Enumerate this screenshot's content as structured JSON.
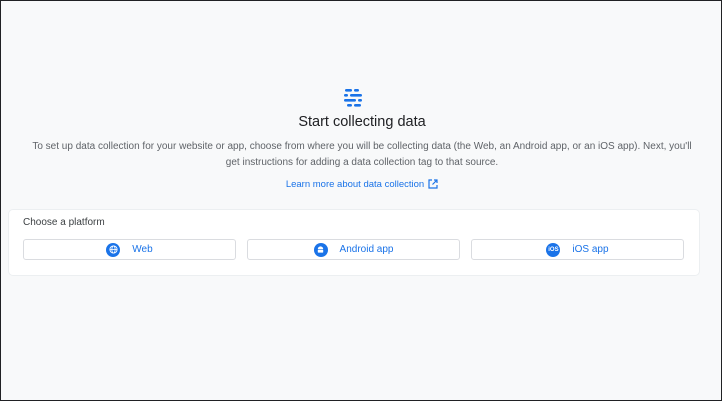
{
  "hero": {
    "icon": "data-collection-icon",
    "title": "Start collecting data",
    "description": "To set up data collection for your website or app, choose from where you will be collecting data (the Web, an Android app, or an iOS app). Next, you'll get instructions for adding a data collection tag to that source.",
    "learn_more": "Learn more about data collection",
    "learn_more_icon": "open-in-new-icon"
  },
  "platform": {
    "heading": "Choose a platform",
    "options": [
      {
        "label": "Web",
        "icon": "globe-icon"
      },
      {
        "label": "Android app",
        "icon": "android-icon"
      },
      {
        "label": "iOS app",
        "icon": "ios-icon",
        "icon_text": "iOS"
      }
    ]
  },
  "colors": {
    "accent": "#1a73e8",
    "background": "#f8f9fa",
    "card": "#ffffff",
    "border": "#dadce0"
  }
}
